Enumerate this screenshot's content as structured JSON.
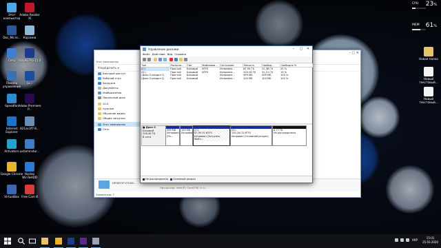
{
  "desktop": {
    "left_icons": [
      {
        "label": "Этот компьютер",
        "color": "#4ea7e6"
      },
      {
        "label": "Adobe Reader XI",
        "color": "#c0182a"
      },
      {
        "label": "Doc_Micro...",
        "color": "#2b579a"
      },
      {
        "label": "Корзина",
        "color": "#8fb7d8"
      },
      {
        "label": "Сеть",
        "color": "#3d7fd0"
      },
      {
        "label": "VEGAS Pro 15.0",
        "color": "#1d3b8c"
      },
      {
        "label": "Панель управления",
        "color": "#3e6fb5"
      },
      {
        "label": "Le...",
        "color": "#1a4e9a"
      },
      {
        "label": "Speedfan",
        "color": "#2e8bd1"
      },
      {
        "label": "Adobe Premiere P...",
        "color": "#2a0a4a"
      },
      {
        "label": "Internet Explorer",
        "color": "#1b73c8"
      },
      {
        "label": "821ac3f7-6...",
        "color": "#6b8fb3"
      },
      {
        "label": "Activators",
        "color": "#24a1d1"
      },
      {
        "label": "uxtaminstur...",
        "color": "#3f7cc4"
      },
      {
        "label": "Google Chrome",
        "color": "#e8b530"
      },
      {
        "label": "Hasleo WinToHDD",
        "color": "#2a7bd4"
      },
      {
        "label": "VirtualBox",
        "color": "#3b66b0"
      },
      {
        "label": "Free Cam 8",
        "color": "#d93b3b"
      }
    ],
    "right_icons": [
      {
        "label": "Новая папка",
        "color": "#e7c46a"
      },
      {
        "label": "Новый текстовый...",
        "color": "#f2f2f2"
      },
      {
        "label": "Новый текстовый...",
        "color": "#f2f2f2"
      }
    ],
    "gauges": [
      {
        "label": "CPU",
        "value": "23",
        "unit": "%",
        "level": 0.23
      },
      {
        "label": "MEM",
        "value": "61",
        "unit": "%",
        "level": 0.61
      }
    ]
  },
  "explorer": {
    "toolbar_label": "Упорядочить ▾",
    "address": "Этот компьютер",
    "nav": [
      {
        "label": "Быстрый доступ",
        "color": "#3a8ee6"
      },
      {
        "label": "Рабочий стол",
        "color": "#4aa0e8"
      },
      {
        "label": "Загрузки",
        "color": "#2d7fd6"
      },
      {
        "label": "Документы",
        "color": "#9bb4d0"
      },
      {
        "label": "Изображения",
        "color": "#4c8fd6"
      },
      {
        "label": "Локальный диск",
        "color": "#888888"
      },
      {
        "label": "10.0",
        "color": "#e7c46a"
      },
      {
        "label": "нужные",
        "color": "#e7c46a"
      },
      {
        "label": "Обучение видео",
        "color": "#e7c46a"
      },
      {
        "label": "Общие загрузки",
        "color": "#e7c46a"
      },
      {
        "label": "Этот компьютер",
        "color": "#4ea7e6"
      },
      {
        "label": "Сеть",
        "color": "#3d7fd0"
      }
    ],
    "pc_name": "DESKTOP-LTG0D...",
    "processor": "Процессор: Intel(R) Core(TM) i3-0...",
    "status": "Элементов: 7"
  },
  "disk_mgmt": {
    "title": "Управление дисками",
    "menu": [
      "Файл",
      "Действие",
      "Вид",
      "Справка"
    ],
    "columns": [
      "Том",
      "Располо...",
      "Тип",
      "Файловая ...",
      "Состояние",
      "Емкость",
      "Свобод...",
      "Свободно %"
    ],
    "rows": [
      [
        "(C:)",
        "Простой",
        "Базовый",
        "NTFS",
        "Исправен...",
        "87,95 ГБ",
        "22,38 ГБ",
        "25 %"
      ],
      [
        "(D:)",
        "Простой",
        "Базовый",
        "NTFS",
        "Исправен...",
        "100,16 ГБ",
        "31,21 ГБ",
        "19 %"
      ],
      [
        "(Диск 0 раздел 1)",
        "Простой",
        "Базовый",
        "",
        "Исправен...",
        "499 МБ",
        "499 МБ",
        "100 %"
      ],
      [
        "(Диск 0 раздел 2)",
        "Простой",
        "Базовый",
        "",
        "Исправен...",
        "100 МБ",
        "100 МБ",
        "100 %"
      ]
    ],
    "disk": {
      "name": "Диск 0",
      "type": "Базовый",
      "size": "238,46 ГБ",
      "status": "В сети"
    },
    "partitions": [
      {
        "title": "",
        "size": "499 МБ",
        "status": "Исправен (Ра...",
        "kind": "primary"
      },
      {
        "title": "",
        "size": "100 МБ",
        "status": "Исправен",
        "kind": "primary"
      },
      {
        "title": "(C:)",
        "size": "87,95 ГБ NTFS",
        "status": "Исправен (Загрузка, Файл...",
        "kind": "selected"
      },
      {
        "title": "(D:)",
        "size": "150,16 ГБ NTFS",
        "status": "Исправен (Основной раздел)",
        "kind": "primary"
      },
      {
        "title": "",
        "size": "6,77 ГБ",
        "status": "Не распределена",
        "kind": "unalloc"
      }
    ],
    "legend": [
      {
        "label": "Не распределена",
        "color": "#111111"
      },
      {
        "label": "Основной раздел",
        "color": "#1a2d9a"
      }
    ]
  },
  "taskbar": {
    "language": "УКР",
    "time": "15:01",
    "date": "25.03.2020",
    "apps": [
      {
        "name": "start",
        "color": "#ffffff"
      },
      {
        "name": "search",
        "color": "#ffffff"
      },
      {
        "name": "task-view",
        "color": "#ffffff"
      },
      {
        "name": "file-explorer",
        "color": "#e7c46a"
      },
      {
        "name": "chrome",
        "color": "#e8b530"
      },
      {
        "name": "vegas",
        "color": "#1d3b8c"
      },
      {
        "name": "premiere",
        "color": "#5a2a8a"
      },
      {
        "name": "disk-management",
        "color": "#9aa4b2"
      }
    ]
  }
}
